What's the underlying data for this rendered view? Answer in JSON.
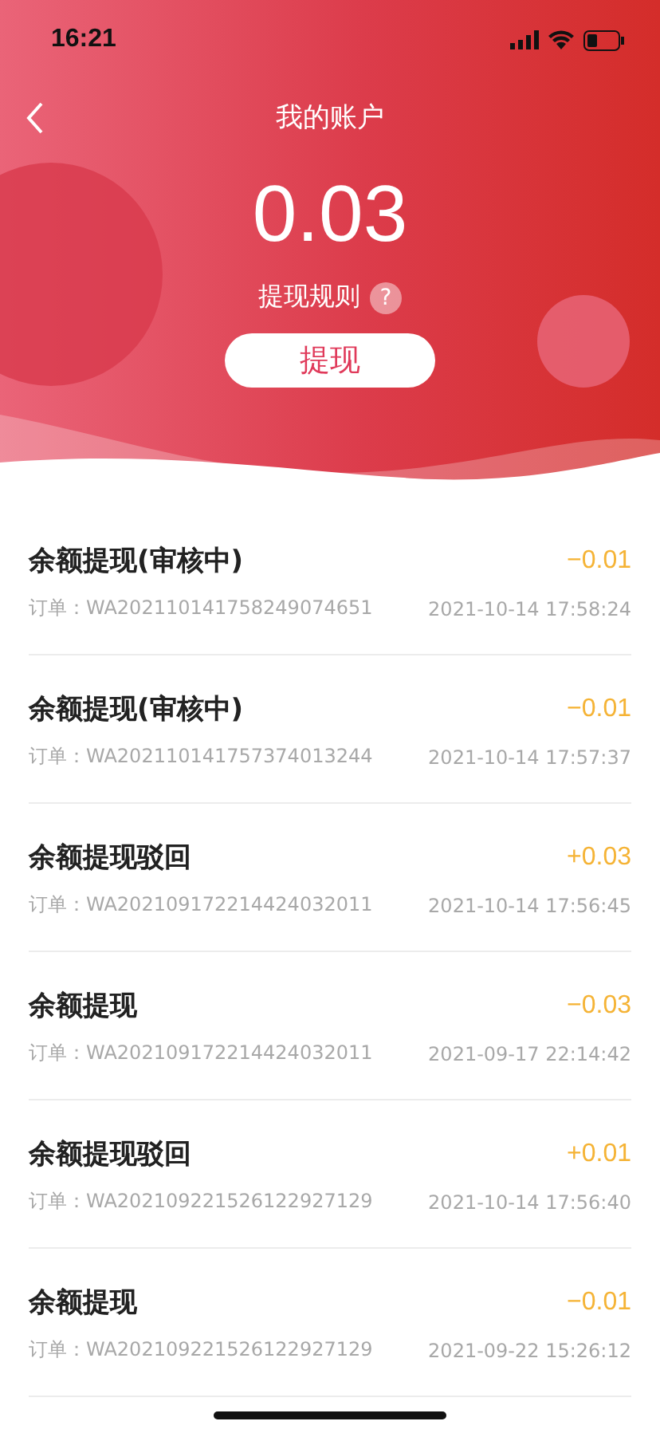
{
  "status_bar": {
    "time": "16:21"
  },
  "nav": {
    "title": "我的账户"
  },
  "balance": {
    "amount": "0.03",
    "rules_label": "提现规则",
    "help_mark": "?"
  },
  "withdraw_button": "提现",
  "records": [
    {
      "title": "余额提现(审核中)",
      "amount": "−0.01",
      "order": "订单：WA202110141758249074651",
      "time": "2021-10-14 17:58:24"
    },
    {
      "title": "余额提现(审核中)",
      "amount": "−0.01",
      "order": "订单：WA202110141757374013244",
      "time": "2021-10-14 17:57:37"
    },
    {
      "title": "余额提现驳回",
      "amount": "+0.03",
      "order": "订单：WA202109172214424032011",
      "time": "2021-10-14 17:56:45"
    },
    {
      "title": "余额提现",
      "amount": "−0.03",
      "order": "订单：WA202109172214424032011",
      "time": "2021-09-17 22:14:42"
    },
    {
      "title": "余额提现驳回",
      "amount": "+0.01",
      "order": "订单：WA202109221526122927129",
      "time": "2021-10-14 17:56:40"
    },
    {
      "title": "余额提现",
      "amount": "−0.01",
      "order": "订单：WA202109221526122927129",
      "time": "2021-09-22 15:26:12"
    }
  ]
}
